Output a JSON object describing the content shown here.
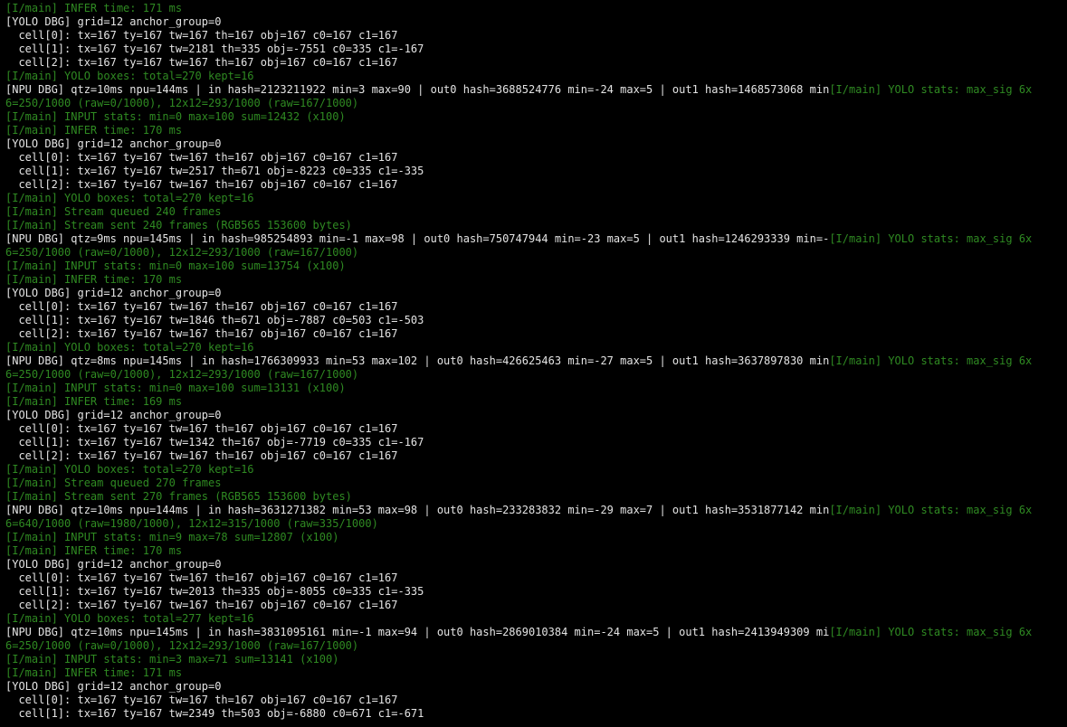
{
  "colors": {
    "background": "#000000",
    "text_white": "#e4e4e4",
    "text_green": "#2f8a22"
  },
  "terminal": {
    "lines": [
      [
        {
          "c": "green",
          "t": "[I/main] INFER time: 171 ms"
        }
      ],
      [
        {
          "c": "white",
          "t": "[YOLO DBG] grid=12 anchor_group=0"
        }
      ],
      [
        {
          "c": "white",
          "t": "  cell[0]: tx=167 ty=167 tw=167 th=167 obj=167 c0=167 c1=167"
        }
      ],
      [
        {
          "c": "white",
          "t": "  cell[1]: tx=167 ty=167 tw=2181 th=335 obj=-7551 c0=335 c1=-167"
        }
      ],
      [
        {
          "c": "white",
          "t": "  cell[2]: tx=167 ty=167 tw=167 th=167 obj=167 c0=167 c1=167"
        }
      ],
      [
        {
          "c": "green",
          "t": "[I/main] YOLO boxes: total=270 kept=16"
        }
      ],
      [
        {
          "c": "white",
          "t": "[NPU DBG] qtz=10ms npu=144ms | in hash=2123211922 min=3 max=90 | out0 hash=3688524776 min=-24 max=5 | out1 hash=1468573068 min"
        },
        {
          "c": "green",
          "t": "[I/main] YOLO stats: max_sig 6x"
        }
      ],
      [
        {
          "c": "green",
          "t": "6=250/1000 (raw=0/1000), 12x12=293/1000 (raw=167/1000)"
        }
      ],
      [
        {
          "c": "green",
          "t": "[I/main] INPUT stats: min=0 max=100 sum=12432 (x100)"
        }
      ],
      [
        {
          "c": "green",
          "t": "[I/main] INFER time: 170 ms"
        }
      ],
      [
        {
          "c": "white",
          "t": "[YOLO DBG] grid=12 anchor_group=0"
        }
      ],
      [
        {
          "c": "white",
          "t": "  cell[0]: tx=167 ty=167 tw=167 th=167 obj=167 c0=167 c1=167"
        }
      ],
      [
        {
          "c": "white",
          "t": "  cell[1]: tx=167 ty=167 tw=2517 th=671 obj=-8223 c0=335 c1=-335"
        }
      ],
      [
        {
          "c": "white",
          "t": "  cell[2]: tx=167 ty=167 tw=167 th=167 obj=167 c0=167 c1=167"
        }
      ],
      [
        {
          "c": "green",
          "t": "[I/main] YOLO boxes: total=270 kept=16"
        }
      ],
      [
        {
          "c": "green",
          "t": "[I/main] Stream queued 240 frames"
        }
      ],
      [
        {
          "c": "green",
          "t": "[I/main] Stream sent 240 frames (RGB565 153600 bytes)"
        }
      ],
      [
        {
          "c": "white",
          "t": "[NPU DBG] qtz=9ms npu=145ms | in hash=985254893 min=-1 max=98 | out0 hash=750747944 min=-23 max=5 | out1 hash=1246293339 min=-"
        },
        {
          "c": "green",
          "t": "[I/main] YOLO stats: max_sig 6x"
        }
      ],
      [
        {
          "c": "green",
          "t": "6=250/1000 (raw=0/1000), 12x12=293/1000 (raw=167/1000)"
        }
      ],
      [
        {
          "c": "green",
          "t": "[I/main] INPUT stats: min=0 max=100 sum=13754 (x100)"
        }
      ],
      [
        {
          "c": "green",
          "t": "[I/main] INFER time: 170 ms"
        }
      ],
      [
        {
          "c": "white",
          "t": "[YOLO DBG] grid=12 anchor_group=0"
        }
      ],
      [
        {
          "c": "white",
          "t": "  cell[0]: tx=167 ty=167 tw=167 th=167 obj=167 c0=167 c1=167"
        }
      ],
      [
        {
          "c": "white",
          "t": "  cell[1]: tx=167 ty=167 tw=1846 th=671 obj=-7887 c0=503 c1=-503"
        }
      ],
      [
        {
          "c": "white",
          "t": "  cell[2]: tx=167 ty=167 tw=167 th=167 obj=167 c0=167 c1=167"
        }
      ],
      [
        {
          "c": "green",
          "t": "[I/main] YOLO boxes: total=270 kept=16"
        }
      ],
      [
        {
          "c": "white",
          "t": "[NPU DBG] qtz=8ms npu=145ms | in hash=1766309933 min=53 max=102 | out0 hash=426625463 min=-27 max=5 | out1 hash=3637897830 min"
        },
        {
          "c": "green",
          "t": "[I/main] YOLO stats: max_sig 6x"
        }
      ],
      [
        {
          "c": "green",
          "t": "6=250/1000 (raw=0/1000), 12x12=293/1000 (raw=167/1000)"
        }
      ],
      [
        {
          "c": "green",
          "t": "[I/main] INPUT stats: min=0 max=100 sum=13131 (x100)"
        }
      ],
      [
        {
          "c": "green",
          "t": "[I/main] INFER time: 169 ms"
        }
      ],
      [
        {
          "c": "white",
          "t": "[YOLO DBG] grid=12 anchor_group=0"
        }
      ],
      [
        {
          "c": "white",
          "t": "  cell[0]: tx=167 ty=167 tw=167 th=167 obj=167 c0=167 c1=167"
        }
      ],
      [
        {
          "c": "white",
          "t": "  cell[1]: tx=167 ty=167 tw=1342 th=167 obj=-7719 c0=335 c1=-167"
        }
      ],
      [
        {
          "c": "white",
          "t": "  cell[2]: tx=167 ty=167 tw=167 th=167 obj=167 c0=167 c1=167"
        }
      ],
      [
        {
          "c": "green",
          "t": "[I/main] YOLO boxes: total=270 kept=16"
        }
      ],
      [
        {
          "c": "green",
          "t": "[I/main] Stream queued 270 frames"
        }
      ],
      [
        {
          "c": "green",
          "t": "[I/main] Stream sent 270 frames (RGB565 153600 bytes)"
        }
      ],
      [
        {
          "c": "white",
          "t": "[NPU DBG] qtz=10ms npu=144ms | in hash=3631271382 min=53 max=98 | out0 hash=233283832 min=-29 max=7 | out1 hash=3531877142 min"
        },
        {
          "c": "green",
          "t": "[I/main] YOLO stats: max_sig 6x"
        }
      ],
      [
        {
          "c": "green",
          "t": "6=640/1000 (raw=1980/1000), 12x12=315/1000 (raw=335/1000)"
        }
      ],
      [
        {
          "c": "green",
          "t": "[I/main] INPUT stats: min=9 max=78 sum=12807 (x100)"
        }
      ],
      [
        {
          "c": "green",
          "t": "[I/main] INFER time: 170 ms"
        }
      ],
      [
        {
          "c": "white",
          "t": "[YOLO DBG] grid=12 anchor_group=0"
        }
      ],
      [
        {
          "c": "white",
          "t": "  cell[0]: tx=167 ty=167 tw=167 th=167 obj=167 c0=167 c1=167"
        }
      ],
      [
        {
          "c": "white",
          "t": "  cell[1]: tx=167 ty=167 tw=2013 th=335 obj=-8055 c0=335 c1=-335"
        }
      ],
      [
        {
          "c": "white",
          "t": "  cell[2]: tx=167 ty=167 tw=167 th=167 obj=167 c0=167 c1=167"
        }
      ],
      [
        {
          "c": "green",
          "t": "[I/main] YOLO boxes: total=277 kept=16"
        }
      ],
      [
        {
          "c": "white",
          "t": "[NPU DBG] qtz=10ms npu=145ms | in hash=3831095161 min=-1 max=94 | out0 hash=2869010384 min=-24 max=5 | out1 hash=2413949309 mi"
        },
        {
          "c": "green",
          "t": "[I/main] YOLO stats: max_sig 6x"
        }
      ],
      [
        {
          "c": "green",
          "t": "6=250/1000 (raw=0/1000), 12x12=293/1000 (raw=167/1000)"
        }
      ],
      [
        {
          "c": "green",
          "t": "[I/main] INPUT stats: min=3 max=71 sum=13141 (x100)"
        }
      ],
      [
        {
          "c": "green",
          "t": "[I/main] INFER time: 171 ms"
        }
      ],
      [
        {
          "c": "white",
          "t": "[YOLO DBG] grid=12 anchor_group=0"
        }
      ],
      [
        {
          "c": "white",
          "t": "  cell[0]: tx=167 ty=167 tw=167 th=167 obj=167 c0=167 c1=167"
        }
      ],
      [
        {
          "c": "white",
          "t": "  cell[1]: tx=167 ty=167 tw=2349 th=503 obj=-6880 c0=671 c1=-671"
        }
      ]
    ]
  }
}
